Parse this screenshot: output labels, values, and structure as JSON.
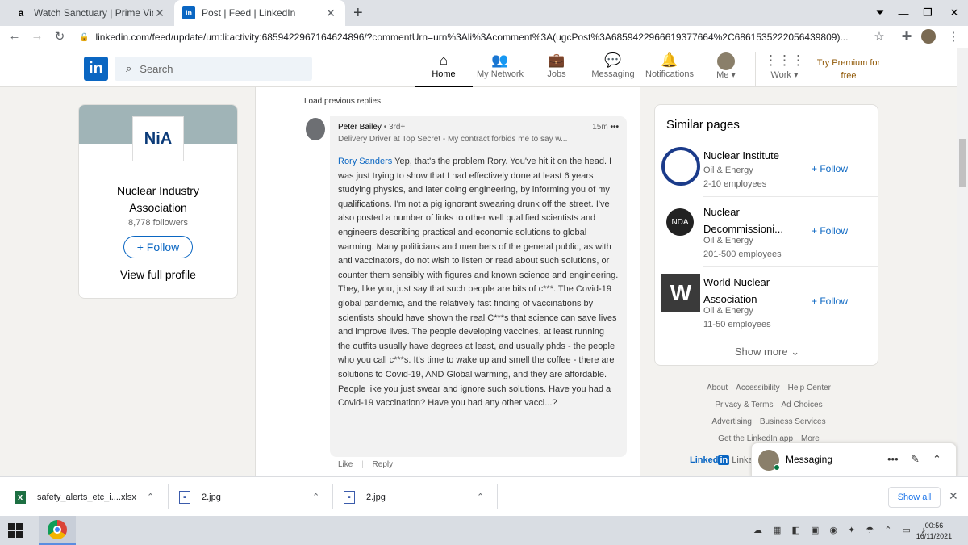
{
  "browser": {
    "tabs": [
      {
        "title": "Watch Sanctuary | Prime Video",
        "favicon": "a"
      },
      {
        "title": "Post | Feed | LinkedIn",
        "favicon": "in"
      }
    ],
    "url": "linkedin.com/feed/update/urn:li:activity:6859422967164624896/?commentUrn=urn%3Ali%3Acomment%3A(ugcPost%3A6859422966619377664%2C6861535222056439809)..."
  },
  "header": {
    "search_placeholder": "Search",
    "nav": [
      {
        "label": "Home",
        "icon": "home-icon"
      },
      {
        "label": "My Network",
        "icon": "network-icon"
      },
      {
        "label": "Jobs",
        "icon": "briefcase-icon"
      },
      {
        "label": "Messaging",
        "icon": "chat-icon"
      },
      {
        "label": "Notifications",
        "icon": "bell-icon"
      },
      {
        "label": "Me",
        "icon": "avatar"
      },
      {
        "label": "Work",
        "icon": "grid-icon"
      }
    ],
    "premium": "Try Premium for free"
  },
  "profile": {
    "name": "Nuclear Industry Association",
    "followers": "8,778 followers",
    "follow": "+ Follow",
    "view_profile": "View full profile"
  },
  "comment": {
    "load_previous": "Load previous replies",
    "author": "Peter Bailey",
    "degree": "• 3rd+",
    "headline": "Delivery Driver at Top Secret - My contract forbids me to say w...",
    "time": "15m",
    "mention": "Rory Sanders",
    "text": "Yep, that's the problem Rory. You've hit it on the head. I was just trying to show that I had effectively done at least 6 years studying physics, and later doing engineering, by informing you of my qualifications. I'm not a pig ignorant swearing drunk off the street. I've also posted a number of links to other well qualified scientists and engineers describing practical and economic solutions to global warming. Many politicians and members of the general public, as with anti vaccinators, do not wish to listen or read about such solutions, or counter them sensibly with figures and known science and engineering. They, like you, just say that such people are bits of c***. The Covid-19 global pandemic, and the relatively fast finding of vaccinations by scientists should have shown the real C***s that science can save lives and improve lives. The people developing vaccines, at least running the outfits usually have degrees at least, and usually phds - the people who you call c***s. It's time to wake up and smell the coffee - there are solutions to Covid-19, AND Global warming, and they are affordable. People like you just swear and ignore such solutions. Have you had a Covid-19 vaccination? Have you had any other vacci...?",
    "like": "Like",
    "reply": "Reply"
  },
  "similar": {
    "title": "Similar pages",
    "pages": [
      {
        "name": "Nuclear Institute",
        "industry": "Oil & Energy",
        "size": "2-10 employees",
        "follow": "Follow"
      },
      {
        "name": "Nuclear Decommissioni...",
        "industry": "Oil & Energy",
        "size": "201-500 employees",
        "follow": "Follow"
      },
      {
        "name": "World Nuclear Association",
        "industry": "Oil & Energy",
        "size": "11-50 employees",
        "follow": "Follow"
      }
    ],
    "show_more": "Show more"
  },
  "footer": {
    "links": [
      "About",
      "Accessibility",
      "Help Center",
      "Privacy & Terms",
      "Ad Choices",
      "Advertising",
      "Business Services",
      "Get the LinkedIn app",
      "More"
    ],
    "brand": "Linked",
    "brand_suffix": "in",
    "brand_tail": "Linke"
  },
  "messaging": {
    "title": "Messaging"
  },
  "downloads": {
    "items": [
      {
        "name": "safety_alerts_etc_i....xlsx"
      },
      {
        "name": "2.jpg"
      },
      {
        "name": "2.jpg"
      }
    ],
    "show_all": "Show all"
  },
  "taskbar": {
    "time": "00:56",
    "date": "16/11/2021"
  }
}
